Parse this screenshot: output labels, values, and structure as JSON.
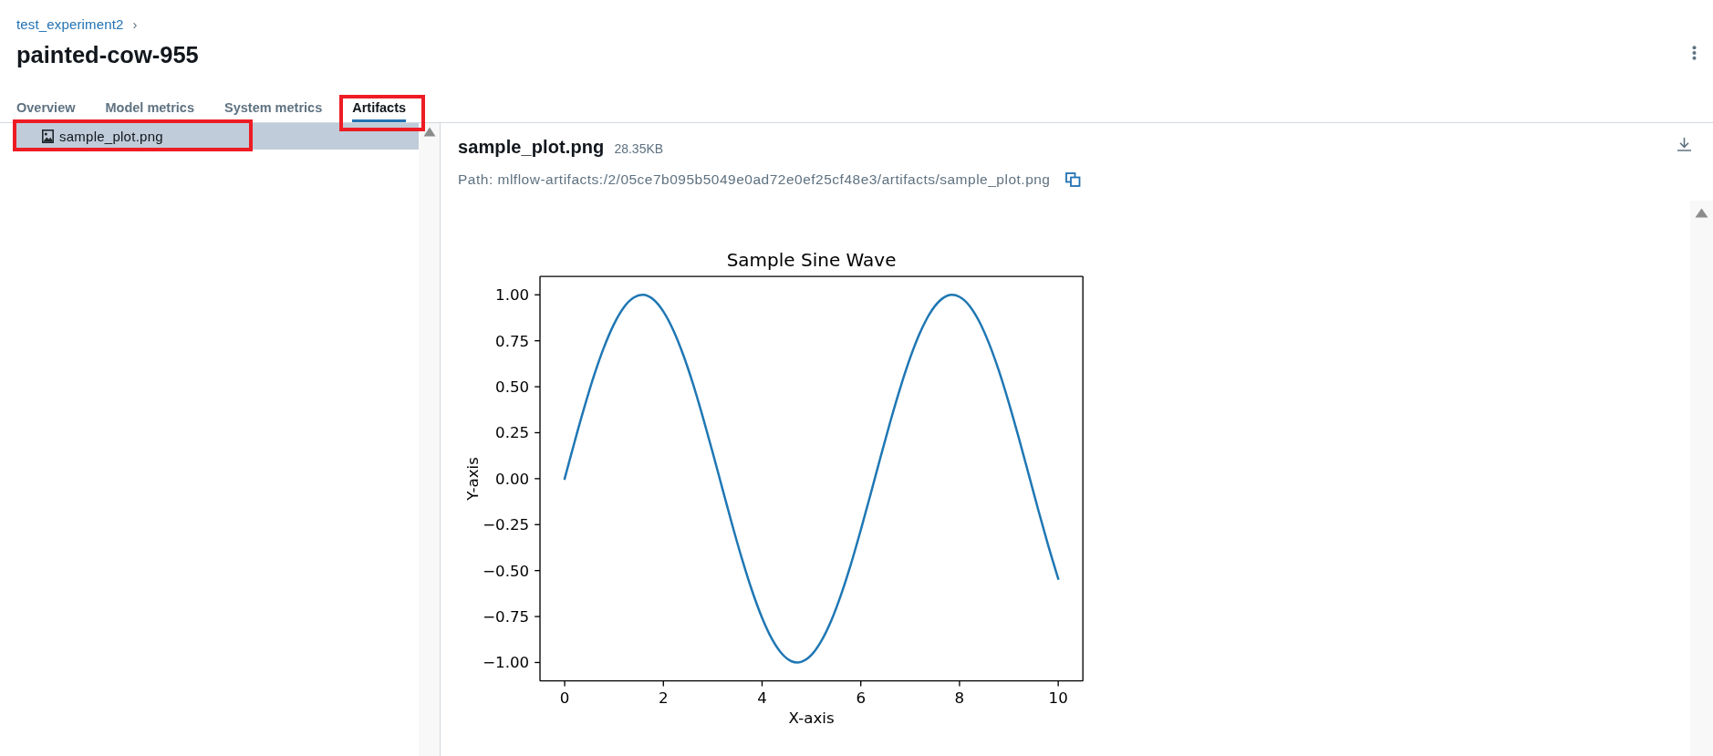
{
  "breadcrumb": {
    "link": "test_experiment2",
    "separator": "›"
  },
  "run_title": "painted-cow-955",
  "tabs": [
    {
      "label": "Overview",
      "selected": false,
      "highlighted": false
    },
    {
      "label": "Model metrics",
      "selected": false,
      "highlighted": false
    },
    {
      "label": "System metrics",
      "selected": false,
      "highlighted": false
    },
    {
      "label": "Artifacts",
      "selected": true,
      "highlighted": true
    }
  ],
  "artifact_tree": {
    "items": [
      {
        "name": "sample_plot.png",
        "selected": true,
        "highlighted": true
      }
    ]
  },
  "preview": {
    "file_name": "sample_plot.png",
    "size": "28.35KB",
    "path": "Path: mlflow-artifacts:/2/05ce7b095b5049e0ad72e0ef25cf48e3/artifacts/sample_plot.png",
    "chart_data": {
      "type": "line",
      "title": "Sample Sine Wave",
      "xlabel": "X-axis",
      "ylabel": "Y-axis",
      "x": [
        0,
        0.2,
        0.4,
        0.6,
        0.8,
        1,
        1.2,
        1.4,
        1.6,
        1.8,
        2,
        2.2,
        2.4,
        2.6,
        2.8,
        3,
        3.2,
        3.4,
        3.6,
        3.8,
        4,
        4.2,
        4.4,
        4.6,
        4.8,
        5,
        5.2,
        5.4,
        5.6,
        5.8,
        6,
        6.2,
        6.4,
        6.6,
        6.8,
        7,
        7.2,
        7.4,
        7.6,
        7.8,
        8,
        8.2,
        8.4,
        8.6,
        8.8,
        9,
        9.2,
        9.4,
        9.6,
        9.8,
        10
      ],
      "values": [
        0,
        0.199,
        0.389,
        0.565,
        0.717,
        0.841,
        0.932,
        0.985,
        1.0,
        0.974,
        0.909,
        0.808,
        0.675,
        0.516,
        0.335,
        0.141,
        -0.058,
        -0.256,
        -0.443,
        -0.612,
        -0.757,
        -0.872,
        -0.952,
        -0.994,
        -0.996,
        -0.959,
        -0.883,
        -0.773,
        -0.631,
        -0.465,
        -0.279,
        -0.083,
        0.117,
        0.312,
        0.494,
        0.657,
        0.794,
        0.899,
        0.968,
        0.999,
        0.989,
        0.941,
        0.855,
        0.734,
        0.585,
        0.412,
        0.223,
        0.025,
        -0.174,
        -0.366,
        -0.544
      ],
      "xlim": [
        -0.5,
        10.5
      ],
      "ylim": [
        -1.1,
        1.1
      ],
      "xticks": [
        0,
        2,
        4,
        6,
        8,
        10
      ],
      "yticks": [
        {
          "value": -1,
          "label": "−1.00"
        },
        {
          "value": -0.75,
          "label": "−0.75"
        },
        {
          "value": -0.5,
          "label": "−0.50"
        },
        {
          "value": -0.25,
          "label": "−0.25"
        },
        {
          "value": 0,
          "label": "0.00"
        },
        {
          "value": 0.25,
          "label": "0.25"
        },
        {
          "value": 0.5,
          "label": "0.50"
        },
        {
          "value": 0.75,
          "label": "0.75"
        },
        {
          "value": 1,
          "label": "1.00"
        }
      ]
    }
  }
}
